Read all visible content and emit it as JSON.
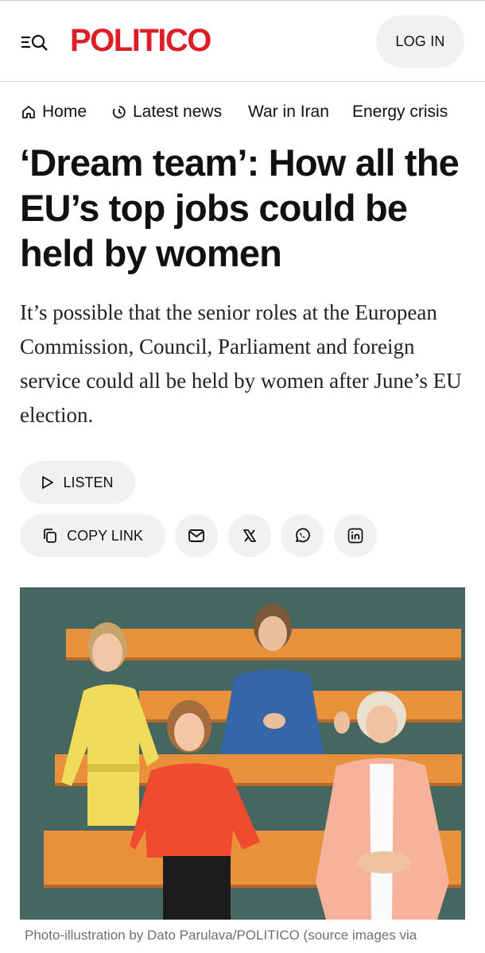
{
  "header": {
    "logo": "POLITICO",
    "login_label": "LOG IN",
    "menu_icon": "menu-search-icon"
  },
  "nav": {
    "items": [
      {
        "label": "Home",
        "icon": "home-icon"
      },
      {
        "label": "Latest news",
        "icon": "clock-icon"
      },
      {
        "label": "War in Iran"
      },
      {
        "label": "Energy crisis"
      }
    ]
  },
  "article": {
    "headline": "‘Dream team’: How all the EU’s top jobs could be held by women",
    "dek": "It’s possible that the senior roles at the European Commission, Council, Parliament and foreign service could all be held by women after June’s EU election.",
    "listen_label": "LISTEN",
    "copy_link_label": "COPY LINK",
    "share_icons": [
      "email-icon",
      "x-icon",
      "whatsapp-icon",
      "linkedin-icon"
    ],
    "photo_caption": "Photo-illustration by Dato Parulava/POLITICO (source images via"
  },
  "colors": {
    "brand": "#dc1f26",
    "pill_bg": "#f1f1f1",
    "photo_bg": "#45675f",
    "stripe": "#e8913a"
  }
}
